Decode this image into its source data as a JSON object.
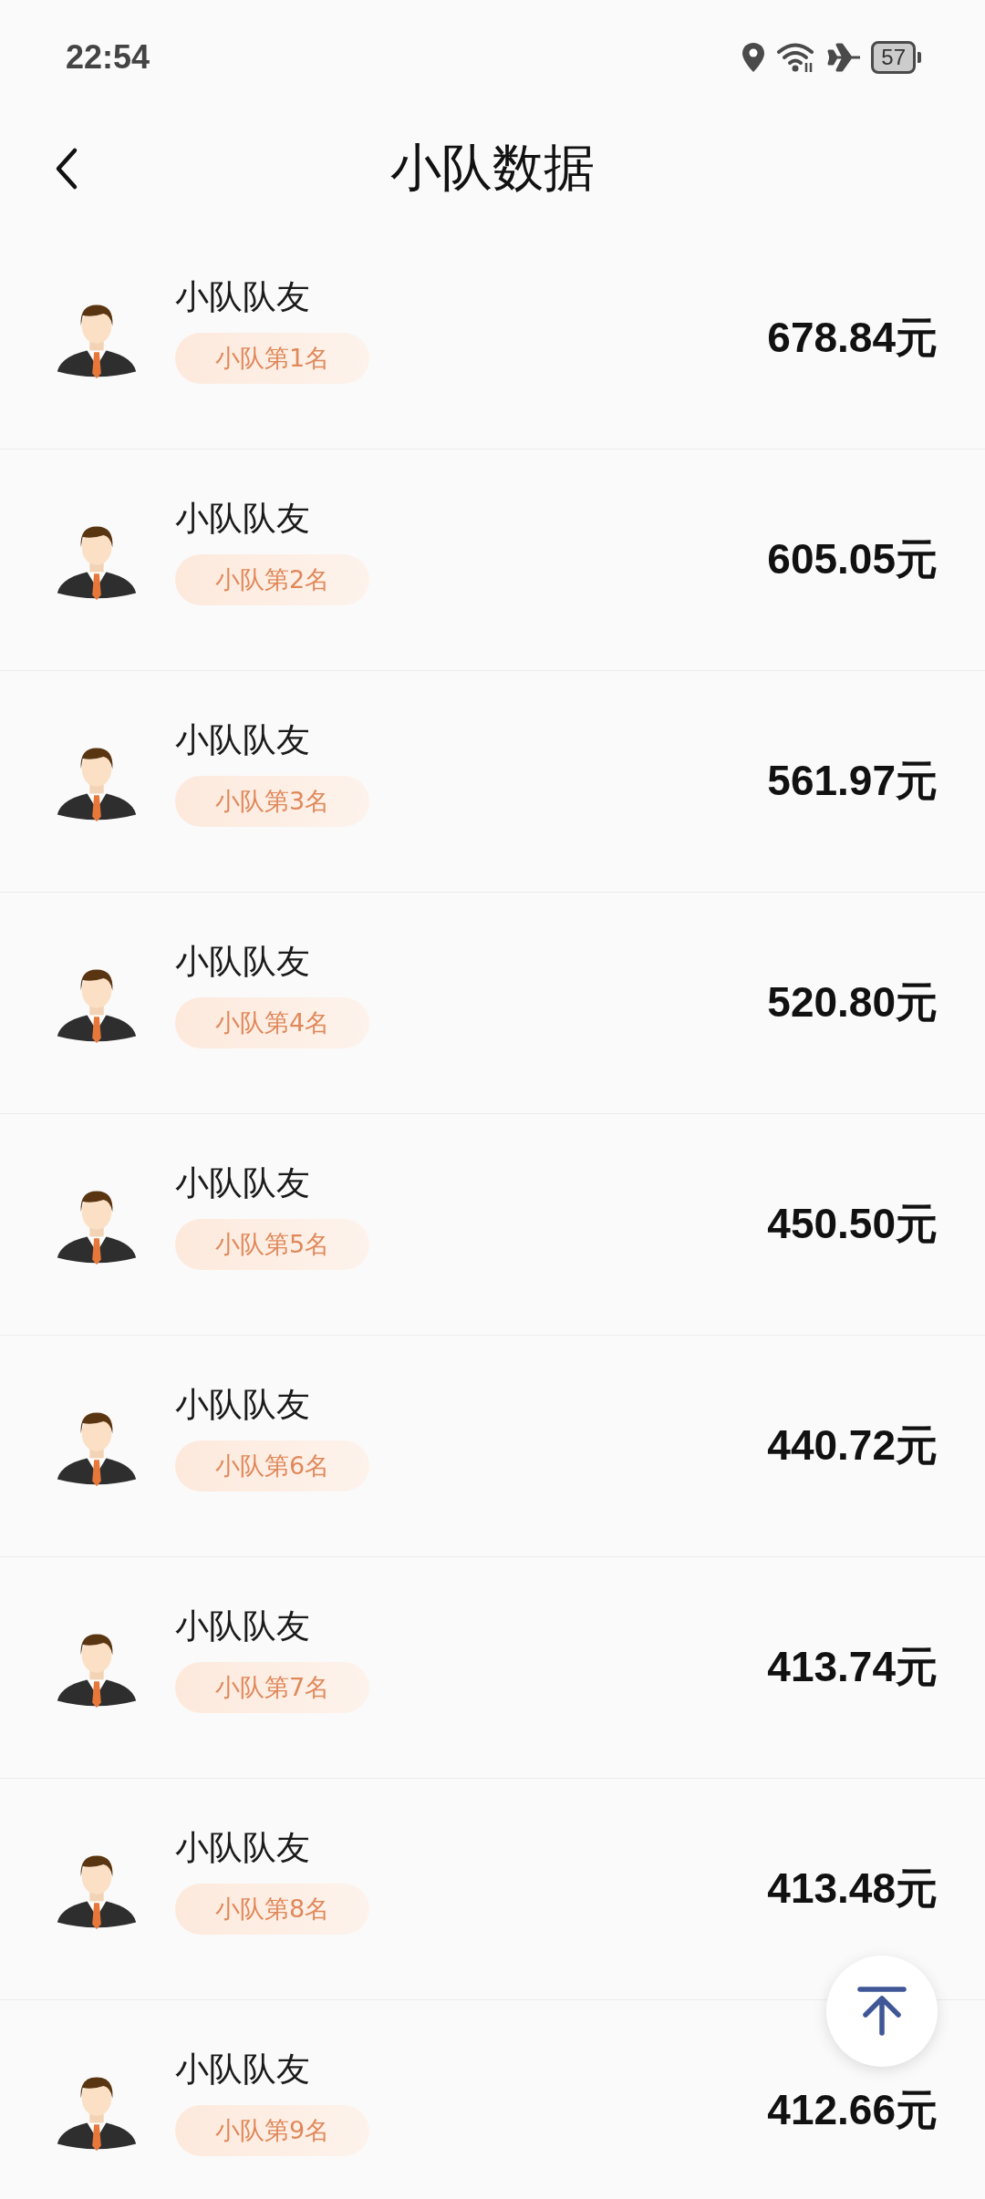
{
  "status_bar": {
    "time": "22:54",
    "battery": "57"
  },
  "header": {
    "title": "小队数据"
  },
  "members": [
    {
      "name": "小队队友",
      "rank": "小队第1名",
      "amount": "678.84元"
    },
    {
      "name": "小队队友",
      "rank": "小队第2名",
      "amount": "605.05元"
    },
    {
      "name": "小队队友",
      "rank": "小队第3名",
      "amount": "561.97元"
    },
    {
      "name": "小队队友",
      "rank": "小队第4名",
      "amount": "520.80元"
    },
    {
      "name": "小队队友",
      "rank": "小队第5名",
      "amount": "450.50元"
    },
    {
      "name": "小队队友",
      "rank": "小队第6名",
      "amount": "440.72元"
    },
    {
      "name": "小队队友",
      "rank": "小队第7名",
      "amount": "413.74元"
    },
    {
      "name": "小队队友",
      "rank": "小队第8名",
      "amount": "413.48元"
    },
    {
      "name": "小队队友",
      "rank": "小队第9名",
      "amount": "412.66元"
    }
  ]
}
